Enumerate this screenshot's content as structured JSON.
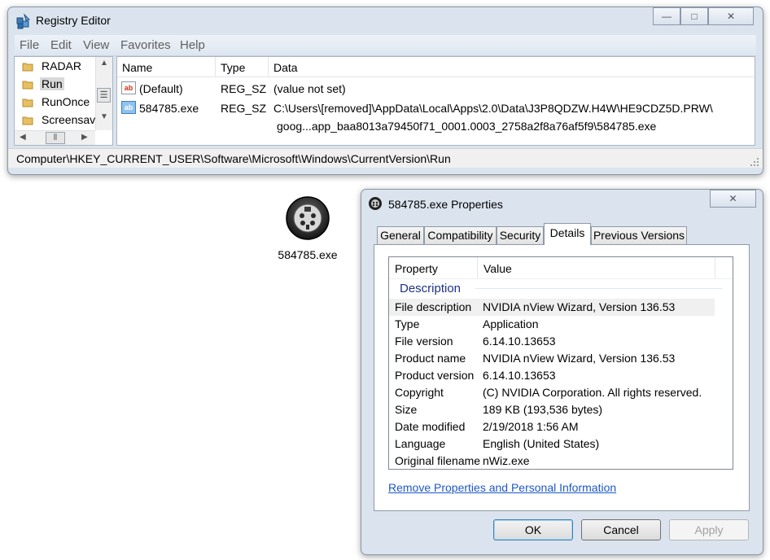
{
  "registry": {
    "title": "Registry Editor",
    "controls": {
      "minimize": "—",
      "maximize": "□",
      "close": "✕"
    },
    "menu": [
      "File",
      "Edit",
      "View",
      "Favorites",
      "Help"
    ],
    "tree": {
      "items": [
        "RADAR",
        "Run",
        "RunOnce",
        "Screensav"
      ],
      "selected": "Run",
      "scroll": {
        "up": "▲",
        "thumb": "☰",
        "down": "▼",
        "left": "◀",
        "hthumb": "⦀",
        "right": "▶"
      }
    },
    "columns": [
      "Name",
      "Type",
      "Data"
    ],
    "values": [
      {
        "name": "(Default)",
        "type": "REG_SZ",
        "data": "(value not set)",
        "data2": "",
        "icon": "ab"
      },
      {
        "name": "584785.exe",
        "type": "REG_SZ",
        "data": "C:\\Users\\[removed]\\AppData\\Local\\Apps\\2.0\\Data\\J3P8QDZW.H4W\\HE9CDZ5D.PRW\\",
        "data2": "goog...app_baa8013a79450f71_0001.0003_2758a2f8a76af5f9\\584785.exe",
        "icon": "ab"
      }
    ],
    "status_path": "Computer\\HKEY_CURRENT_USER\\Software\\Microsoft\\Windows\\CurrentVersion\\Run",
    "colors": {
      "chrome": "#dbe4ee",
      "folder": "#e8c063"
    }
  },
  "desktop_icon": {
    "label": "584785.exe",
    "icon": "svideo-connector-icon"
  },
  "properties": {
    "title": "584785.exe Properties",
    "close": "✕",
    "tabs": [
      "General",
      "Compatibility",
      "Security",
      "Details",
      "Previous Versions"
    ],
    "active_tab": "Details",
    "columns": [
      "Property",
      "Value"
    ],
    "group": "Description",
    "rows": [
      {
        "name": "File description",
        "value": "NVIDIA nView Wizard, Version 136.53"
      },
      {
        "name": "Type",
        "value": "Application"
      },
      {
        "name": "File version",
        "value": "6.14.10.13653"
      },
      {
        "name": "Product name",
        "value": "NVIDIA nView Wizard, Version 136.53"
      },
      {
        "name": "Product version",
        "value": "6.14.10.13653"
      },
      {
        "name": "Copyright",
        "value": "(C) NVIDIA Corporation. All rights reserved."
      },
      {
        "name": "Size",
        "value": "189 KB (193,536 bytes)"
      },
      {
        "name": "Date modified",
        "value": "2/19/2018 1:56 AM"
      },
      {
        "name": "Language",
        "value": "English (United States)"
      },
      {
        "name": "Original filename",
        "value": "nWiz.exe"
      }
    ],
    "remove_link": "Remove Properties and Personal Information",
    "buttons": {
      "ok": "OK",
      "cancel": "Cancel",
      "apply": "Apply"
    }
  }
}
